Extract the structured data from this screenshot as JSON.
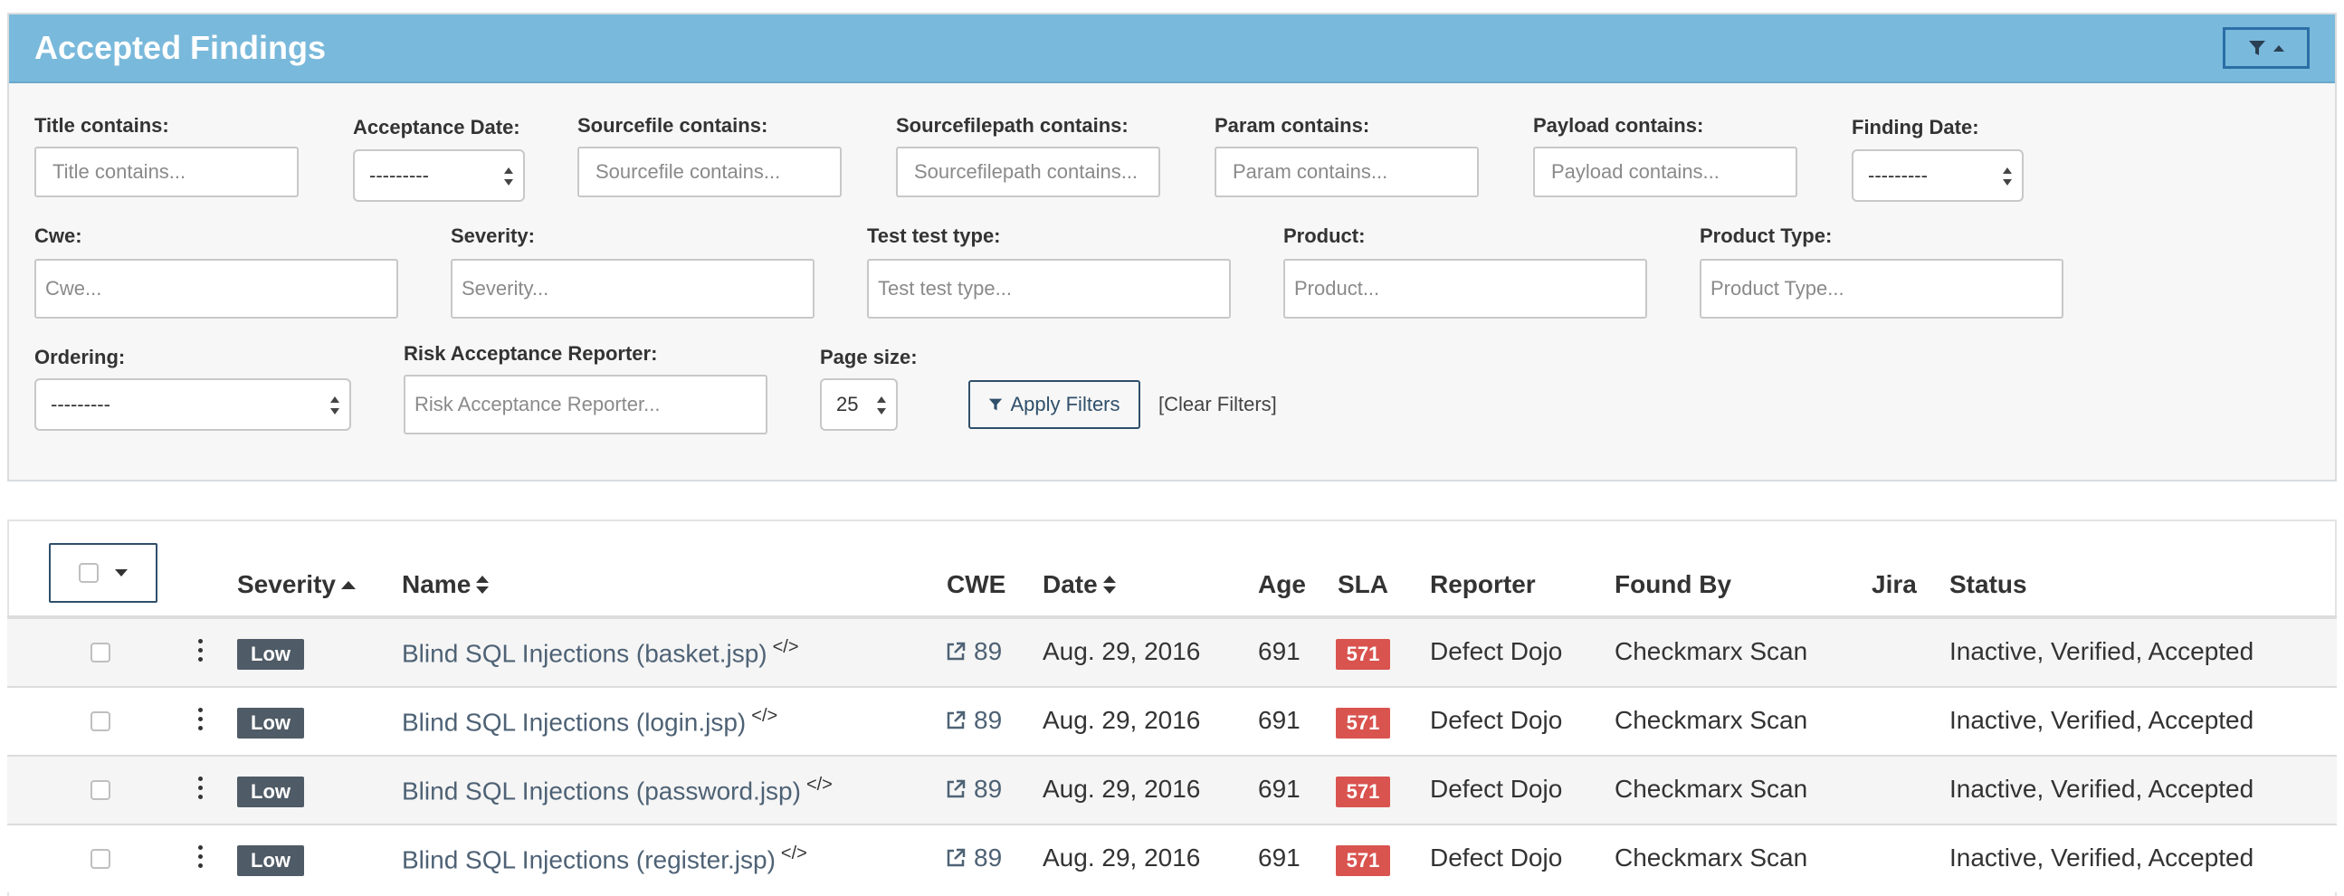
{
  "panel": {
    "title": "Accepted Findings",
    "toggle_icon": "filter-icon",
    "heading_color": "#79b9db"
  },
  "filters": {
    "title_contains": {
      "label": "Title contains:",
      "placeholder": "Title contains..."
    },
    "acceptance_date": {
      "label": "Acceptance Date:",
      "value": "---------"
    },
    "sourcefile_contains": {
      "label": "Sourcefile contains:",
      "placeholder": "Sourcefile contains..."
    },
    "sourcefilepath_contains": {
      "label": "Sourcefilepath contains:",
      "placeholder": "Sourcefilepath contains..."
    },
    "param_contains": {
      "label": "Param contains:",
      "placeholder": "Param contains..."
    },
    "payload_contains": {
      "label": "Payload contains:",
      "placeholder": "Payload contains..."
    },
    "finding_date": {
      "label": "Finding Date:",
      "value": "---------"
    },
    "cwe": {
      "label": "Cwe:",
      "placeholder": "Cwe..."
    },
    "severity": {
      "label": "Severity:",
      "placeholder": "Severity..."
    },
    "test_type": {
      "label": "Test test type:",
      "placeholder": "Test test type..."
    },
    "product": {
      "label": "Product:",
      "placeholder": "Product..."
    },
    "product_type": {
      "label": "Product Type:",
      "placeholder": "Product Type..."
    },
    "ordering": {
      "label": "Ordering:",
      "value": "---------"
    },
    "reporter": {
      "label": "Risk Acceptance Reporter:",
      "placeholder": "Risk Acceptance Reporter..."
    },
    "page_size": {
      "label": "Page size:",
      "value": "25"
    },
    "apply_label": "Apply Filters",
    "clear_label": "[Clear Filters]"
  },
  "table": {
    "headers": {
      "severity": "Severity",
      "name": "Name",
      "cwe": "CWE",
      "date": "Date",
      "age": "Age",
      "sla": "SLA",
      "reporter": "Reporter",
      "found_by": "Found By",
      "jira": "Jira",
      "status": "Status"
    },
    "rows": [
      {
        "severity": "Low",
        "name": "Blind SQL Injections (basket.jsp)",
        "cwe": "89",
        "date": "Aug. 29, 2016",
        "age": "691",
        "sla": "571",
        "reporter": "Defect Dojo",
        "found_by": "Checkmarx Scan",
        "status": "Inactive, Verified, Accepted"
      },
      {
        "severity": "Low",
        "name": "Blind SQL Injections (login.jsp)",
        "cwe": "89",
        "date": "Aug. 29, 2016",
        "age": "691",
        "sla": "571",
        "reporter": "Defect Dojo",
        "found_by": "Checkmarx Scan",
        "status": "Inactive, Verified, Accepted"
      },
      {
        "severity": "Low",
        "name": "Blind SQL Injections (password.jsp)",
        "cwe": "89",
        "date": "Aug. 29, 2016",
        "age": "691",
        "sla": "571",
        "reporter": "Defect Dojo",
        "found_by": "Checkmarx Scan",
        "status": "Inactive, Verified, Accepted"
      },
      {
        "severity": "Low",
        "name": "Blind SQL Injections (register.jsp)",
        "cwe": "89",
        "date": "Aug. 29, 2016",
        "age": "691",
        "sla": "571",
        "reporter": "Defect Dojo",
        "found_by": "Checkmarx Scan",
        "status": "Inactive, Verified, Accepted"
      }
    ],
    "severity_badge_color": "#4f5b66",
    "sla_badge_color": "#d9534f"
  }
}
